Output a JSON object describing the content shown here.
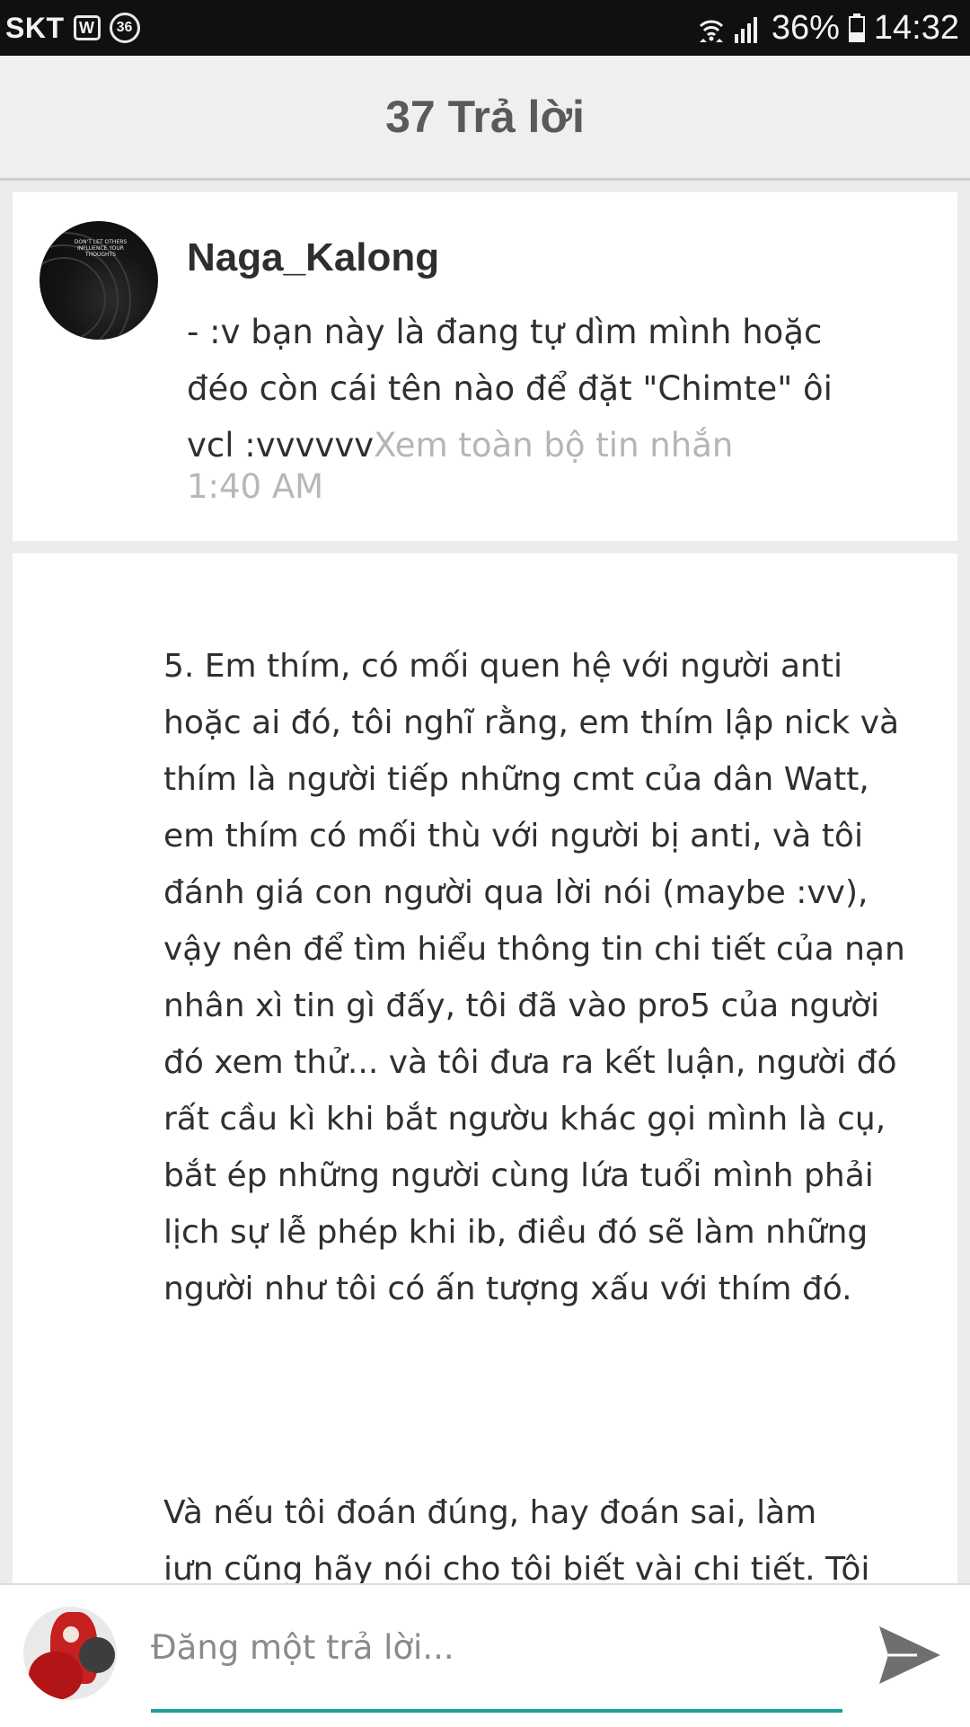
{
  "status_bar": {
    "carrier": "SKT",
    "app_icon": "W",
    "notification_count": "36",
    "battery_percent": "36%",
    "battery_level": 0.36,
    "time": "14:32",
    "icons": [
      "wifi-icon",
      "signal-icon",
      "battery-icon"
    ]
  },
  "header": {
    "title": "37 Trả lời"
  },
  "comment": {
    "author": "Naga_Kalong",
    "avatar_text": "DON'T LET OTHERS INFLUENCE YOUR THOUGHTS",
    "line1": "- :v bạn này là đang tự dìm mình hoặc",
    "line2": "đéo còn cái tên nào để đặt \"Chimte\" ôi",
    "line3": "vcl :vvvvvv",
    "see_more": "Xem toàn bộ tin nhắn",
    "time": "1:40 AM"
  },
  "story": {
    "paragraph1": "5. Em thím, có mối quen hệ với người anti\nhoặc ai đó, tôi nghĩ rằng, em thím lập nick và\nthím là người tiếp những cmt của dân Watt,\nem thím có mối thù với người bị anti, và tôi\nđánh giá con người qua lời nói (maybe :vv),\nvậy nên để tìm hiểu thông tin chi tiết của nạn\nnhân xì tin gì đấy, tôi đã vào pro5 của người\nđó xem thử... và tôi đưa ra kết luận, người đó\nrất cầu kì khi bắt ngườu khác gọi mình là cụ,\nbắt ép những người cùng lứa tuổi mình phải\nlịch sự lễ phép khi ib, điều đó sẽ làm những\nngười như tôi có ấn tượng xấu với thím đó.",
    "paragraph2": "Và nếu tôi đoán đúng, hay đoán sai, làm\niưn cũng hãy nói cho tôi biết vài chi tiết. Tôi\nbiết tôi sẽ đéo thể giúp được thím, nhưng"
  },
  "reply_bar": {
    "placeholder": "Đăng một trả lời...",
    "accent_color": "#1f9e9a"
  }
}
